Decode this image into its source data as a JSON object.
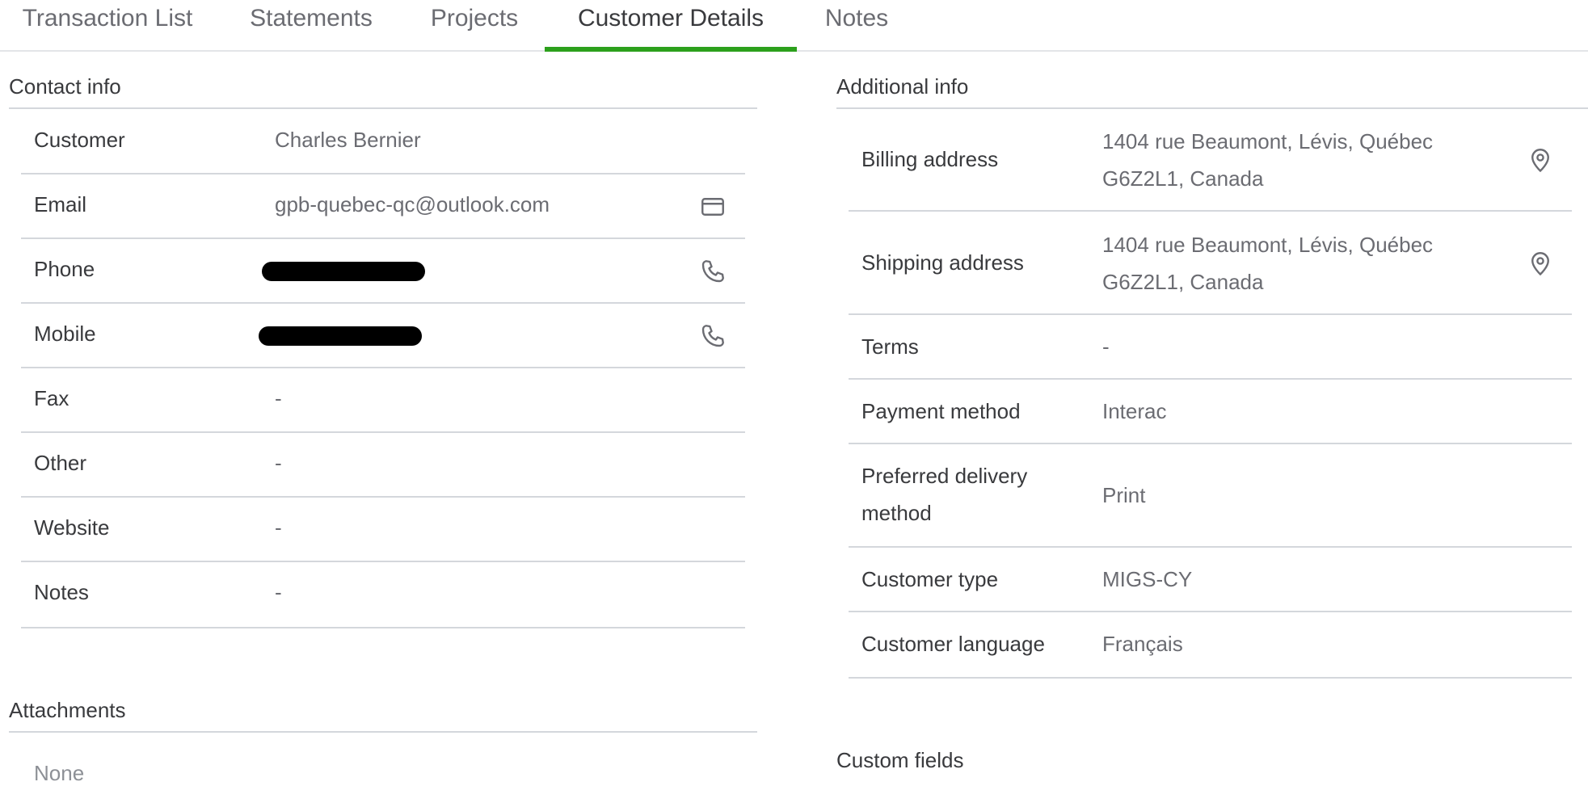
{
  "tabs": [
    {
      "label": "Transaction List",
      "active": false
    },
    {
      "label": "Statements",
      "active": false
    },
    {
      "label": "Projects",
      "active": false
    },
    {
      "label": "Customer Details",
      "active": true
    },
    {
      "label": "Notes",
      "active": false
    }
  ],
  "accent_color": "#2ca01c",
  "contact": {
    "title": "Contact info",
    "rows": [
      {
        "label": "Customer",
        "value": "Charles Bernier"
      },
      {
        "label": "Email",
        "value": "gpb-quebec-qc@outlook.com",
        "icon": "mail-icon"
      },
      {
        "label": "Phone",
        "value": "",
        "redacted": true,
        "icon": "phone-icon"
      },
      {
        "label": "Mobile",
        "value": "",
        "redacted": true,
        "icon": "phone-icon"
      },
      {
        "label": "Fax",
        "value": "-"
      },
      {
        "label": "Other",
        "value": "-"
      },
      {
        "label": "Website",
        "value": "-"
      },
      {
        "label": "Notes",
        "value": "-"
      }
    ]
  },
  "attachments": {
    "title": "Attachments",
    "value": "None"
  },
  "additional": {
    "title": "Additional info",
    "rows": [
      {
        "label": "Billing address",
        "value_line1": "1404 rue Beaumont, Lévis, Québec",
        "value_line2": "G6Z2L1, Canada",
        "icon": "map-pin-icon"
      },
      {
        "label": "Shipping address",
        "value_line1": "1404 rue Beaumont, Lévis, Québec",
        "value_line2": "G6Z2L1, Canada",
        "icon": "map-pin-icon"
      },
      {
        "label": "Terms",
        "value": "-"
      },
      {
        "label": "Payment method",
        "value": "Interac"
      },
      {
        "label_line1": "Preferred delivery",
        "label_line2": "method",
        "value": "Print"
      },
      {
        "label": "Customer type",
        "value": "MIGS-CY"
      },
      {
        "label": "Customer language",
        "value": "Français"
      }
    ]
  },
  "custom_fields": {
    "title": "Custom fields"
  }
}
